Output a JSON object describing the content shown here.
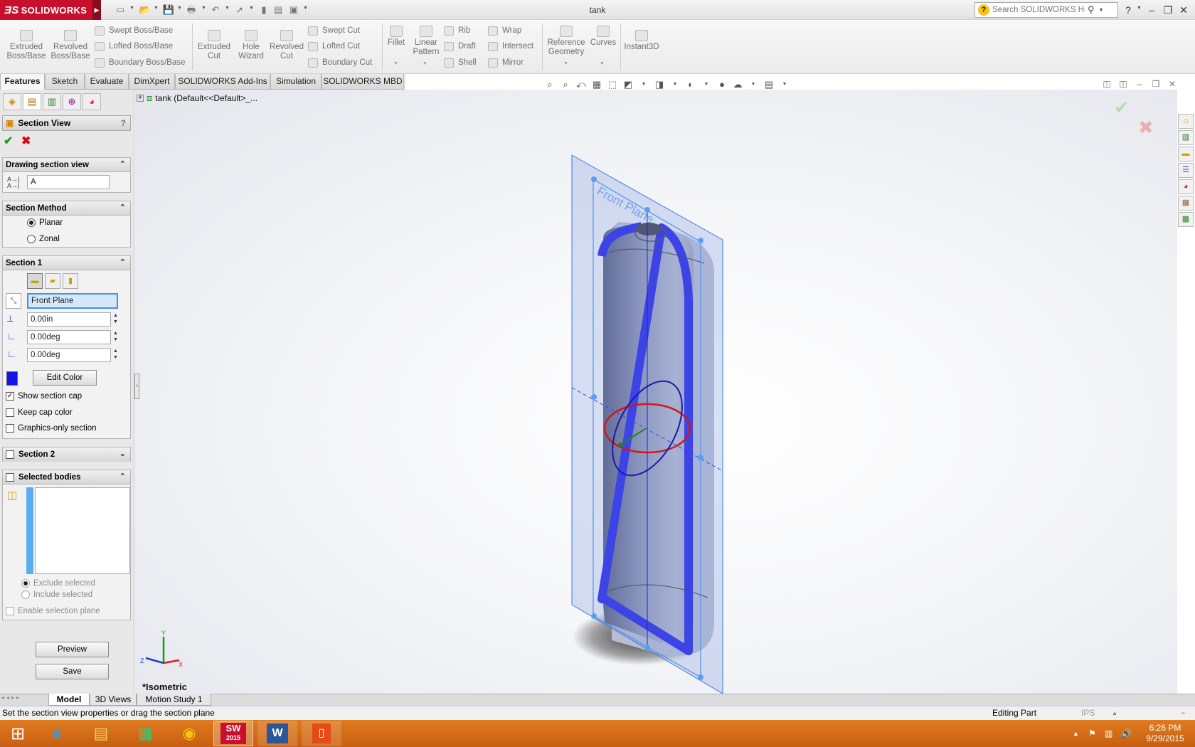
{
  "app": {
    "name": "SOLIDWORKS",
    "doc_title": "tank"
  },
  "help_search": {
    "placeholder": "Search SOLIDWORKS Help"
  },
  "ribbon": {
    "extruded_boss": "Extruded Boss/Base",
    "revolved_boss": "Revolved Boss/Base",
    "swept_boss": "Swept Boss/Base",
    "lofted_boss": "Lofted Boss/Base",
    "boundary_boss": "Boundary Boss/Base",
    "extruded_cut": "Extruded Cut",
    "hole_wizard": "Hole Wizard",
    "revolved_cut": "Revolved Cut",
    "swept_cut": "Swept Cut",
    "lofted_cut": "Lofted Cut",
    "boundary_cut": "Boundary Cut",
    "fillet": "Fillet",
    "linear_pattern": "Linear Pattern",
    "rib": "Rib",
    "draft": "Draft",
    "shell": "Shell",
    "wrap": "Wrap",
    "intersect": "Intersect",
    "mirror": "Mirror",
    "reference_geometry": "Reference Geometry",
    "curves": "Curves",
    "instant3d": "Instant3D"
  },
  "tabs": [
    "Features",
    "Sketch",
    "Evaluate",
    "DimXpert",
    "SOLIDWORKS Add-Ins",
    "Simulation",
    "SOLIDWORKS MBD"
  ],
  "feature_tree": {
    "root": "tank  (Default<<Default>_..."
  },
  "property_manager": {
    "title": "Section View",
    "help": "?",
    "drawing_section": {
      "header": "Drawing section view",
      "name_value": "A"
    },
    "section_method": {
      "header": "Section Method",
      "planar": "Planar",
      "zonal": "Zonal",
      "selected": "Planar"
    },
    "section1": {
      "header": "Section 1",
      "plane": "Front Plane",
      "offset": "0.00in",
      "rot_x": "0.00deg",
      "rot_y": "0.00deg",
      "edit_color": "Edit Color",
      "show_cap": "Show section cap",
      "keep_cap_color": "Keep cap color",
      "graphics_only": "Graphics-only section",
      "section_color": "#1414e6"
    },
    "section2": {
      "header": "Section 2"
    },
    "selected_bodies": {
      "header": "Selected bodies",
      "exclude": "Exclude selected",
      "include": "Include selected",
      "enable_plane": "Enable selection plane"
    },
    "preview": "Preview",
    "save": "Save"
  },
  "viewport": {
    "plane_label": "Front Plane",
    "view_name": "*Isometric",
    "triad": {
      "x": "X",
      "y": "Y",
      "z": "Z"
    }
  },
  "bottom_tabs": [
    "Model",
    "3D Views",
    "Motion Study 1"
  ],
  "status": {
    "message": "Set the section view properties or drag the section plane",
    "mode": "Editing Part",
    "units": "IPS"
  },
  "taskbar": {
    "time": "6:26 PM",
    "date": "9/29/2015",
    "sw_badge": "2015"
  }
}
